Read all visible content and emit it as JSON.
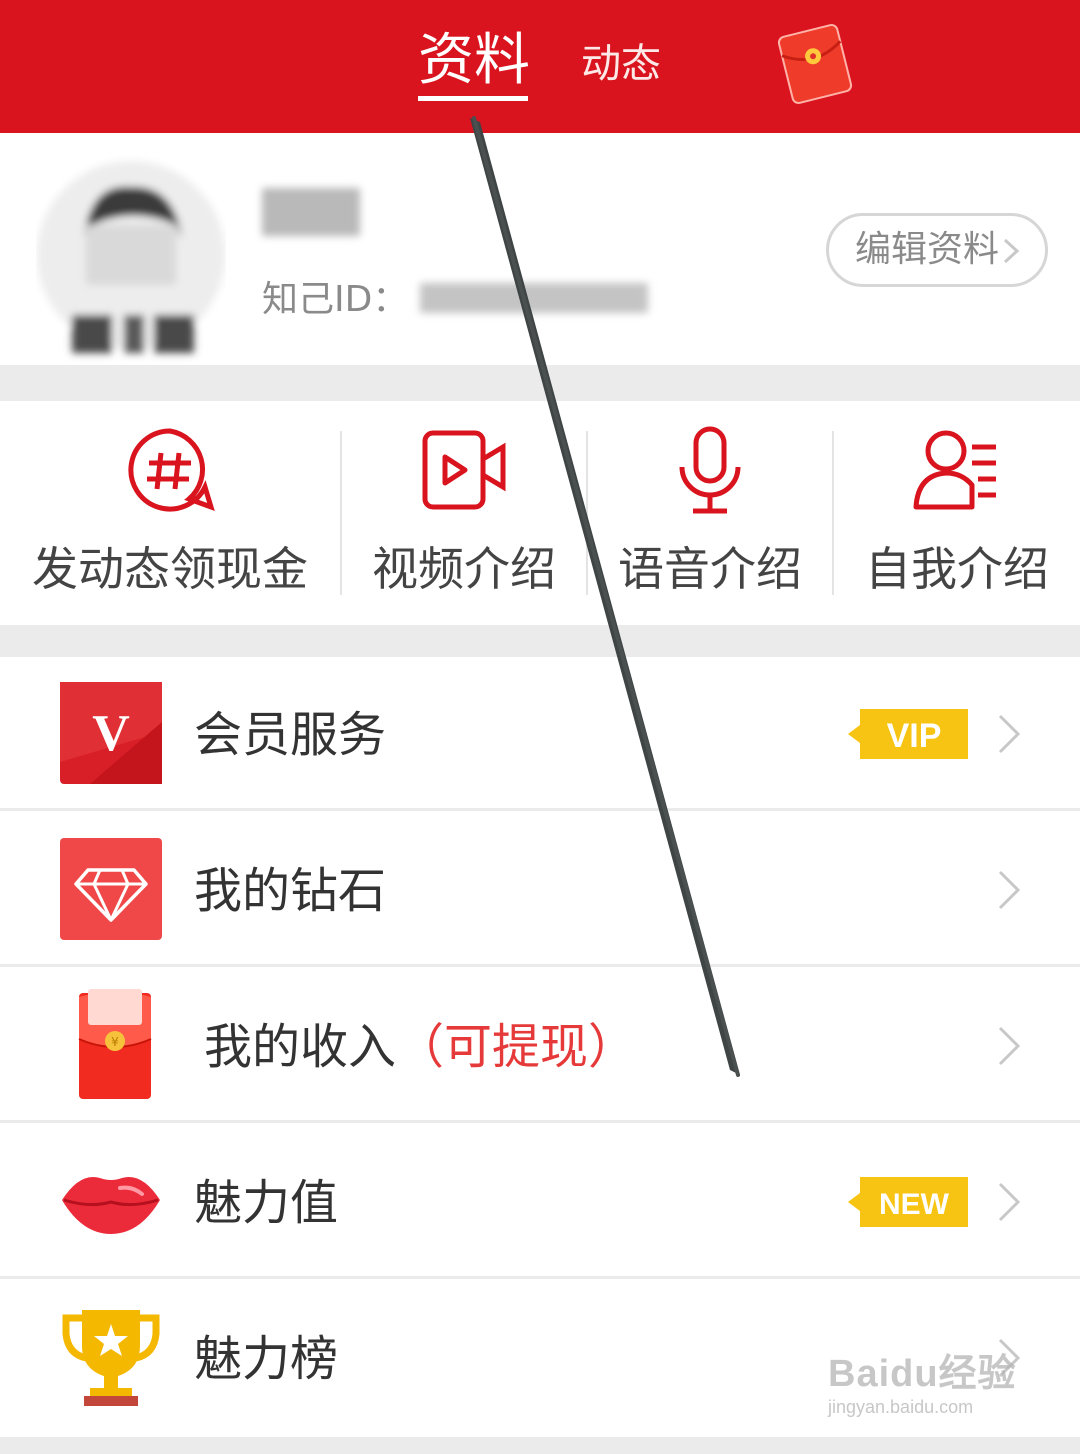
{
  "header": {
    "tabs": [
      {
        "label": "资料",
        "active": true
      },
      {
        "label": "动态",
        "active": false
      }
    ],
    "redpacket_icon": "red-envelope-icon",
    "bg_color": "#d9141e"
  },
  "profile": {
    "id_label": "知己ID：",
    "edit_button_label": "编辑资料"
  },
  "quick_actions": [
    {
      "label": "发动态领现金",
      "icon": "hashtag-bubble-icon"
    },
    {
      "label": "视频介绍",
      "icon": "video-camera-icon"
    },
    {
      "label": "语音介绍",
      "icon": "microphone-icon"
    },
    {
      "label": "自我介绍",
      "icon": "person-list-icon"
    }
  ],
  "menu": [
    {
      "label": "会员服务",
      "icon": "vip-v-icon",
      "badge": "VIP"
    },
    {
      "label": "我的钻石",
      "icon": "diamond-icon"
    },
    {
      "label": "我的收入",
      "highlight": "（可提现）",
      "icon": "red-envelope-icon"
    },
    {
      "label": "魅力值",
      "icon": "lips-icon",
      "badge": "NEW"
    },
    {
      "label": "魅力榜",
      "icon": "trophy-icon"
    }
  ],
  "watermark": {
    "line1": "Baidu经验",
    "line2": "jingyan.baidu.com"
  },
  "colors": {
    "accent": "#d9141e",
    "badge": "#f7c413",
    "highlight": "#e63a3a"
  }
}
